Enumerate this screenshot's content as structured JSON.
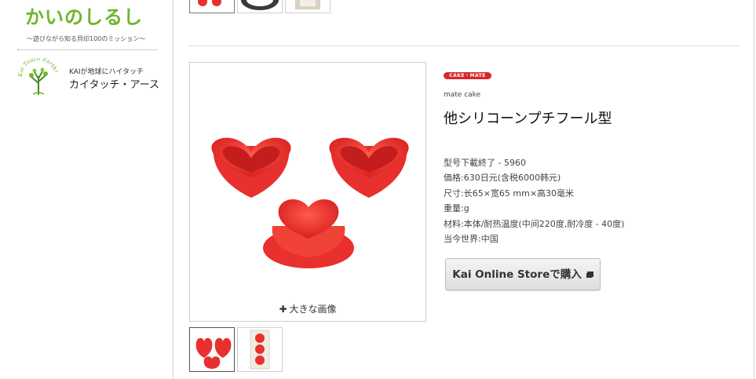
{
  "sidebar": {
    "logo1": {
      "title": "かいのしるし",
      "subtitle": "〜遊びながら知る貝印100のミッション〜"
    },
    "logo2": {
      "mark_text": "Kai Touch Earth!",
      "line1": "KAIが地球にハイタッチ",
      "line2": "カイタッチ・アース"
    }
  },
  "product": {
    "brand_logo_text": "CAKE・MATE",
    "brand_name": "mate cake",
    "title": "他シリコーンプチフール型",
    "specs": [
      "型号下載終了 - 5960",
      "価格:630日元(含税6000韩元)",
      "尺寸:长65×宽65 mm×高30毫米",
      "重量:g",
      "材料:本体/耐热温度(中间220度,耐冷度 - 40度)",
      "当今世界:中国"
    ],
    "buy_button_label": "Kai Online Storeで購入",
    "zoom_label": "大きな画像"
  },
  "colors": {
    "accent_green": "#6fb52c",
    "mold_red": "#e8302e",
    "brand_red": "#d8282d"
  },
  "icons": [
    "plus-icon",
    "external-link-icon",
    "tree-logo-icon"
  ]
}
